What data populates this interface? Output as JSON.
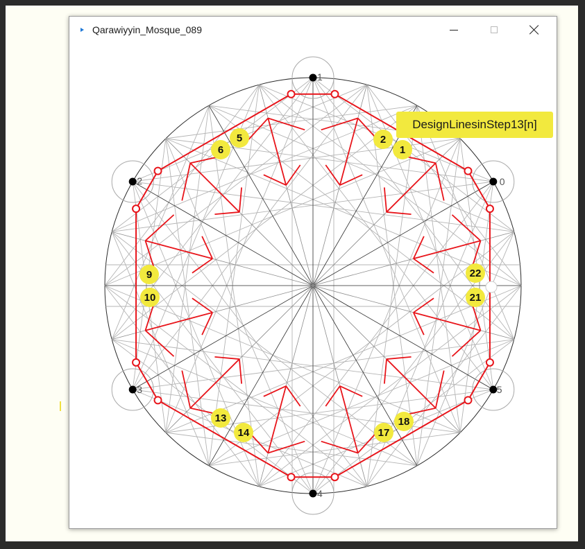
{
  "window": {
    "title": "Qarawiyyin_Mosque_089"
  },
  "controls": {
    "minimize": "minimize",
    "maximize": "maximize",
    "close": "close"
  },
  "tooltip": "DesignLinesinStep13[n]",
  "vertex_labels": [
    "0",
    "1",
    "2",
    "3",
    "4",
    "5"
  ],
  "callouts": [
    "1",
    "2",
    "5",
    "6",
    "9",
    "10",
    "13",
    "14",
    "17",
    "18",
    "21",
    "22"
  ],
  "colors": {
    "design_lines": "#e8141a",
    "construction_lines": "#9a9a9a",
    "main_lines": "#2a2a2a",
    "callout_fill": "#f2e93e",
    "tooltip_fill": "#f2e93e",
    "backdrop": "#fefef4"
  }
}
